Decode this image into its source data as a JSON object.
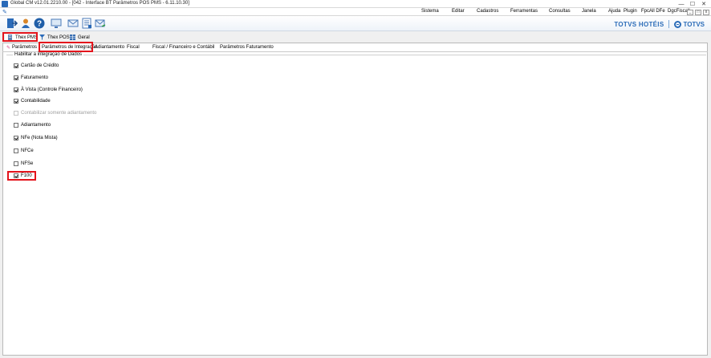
{
  "window": {
    "title": "Global CM v12.01.2210.00 - [042 - Interface BT Parâmetros POS PMS - 6.11.10.30]",
    "controls": [
      "—",
      "☐",
      "✕"
    ]
  },
  "menu": {
    "items": [
      "Sistema",
      "Editar",
      "Cadastros",
      "Ferramentas",
      "Consultas",
      "Janela",
      "Ajuda",
      "Plugin",
      "FpcAll DFe",
      "DgcFiscall"
    ],
    "mini_controls": [
      "_",
      "□",
      "x"
    ]
  },
  "toolbar": {
    "buttons": [
      "exit-icon",
      "user-icon",
      "help-icon",
      "monitor-icon",
      "mail-icon",
      "report-icon",
      "send-mail-icon"
    ],
    "brand_hoteis": "TOTVS HOTÉIS",
    "brand_totvs": "TOTVS"
  },
  "tabs_level1": [
    {
      "label": "Thex PMS",
      "icon": "building-icon",
      "active": true
    },
    {
      "label": "Thex POS",
      "icon": "filter-icon",
      "active": false
    },
    {
      "label": "Geral",
      "icon": "grid-icon",
      "active": false
    }
  ],
  "tabs_level2": [
    {
      "label": "Parâmetros",
      "active": false
    },
    {
      "label": "Parâmetros de Integração",
      "active": true
    },
    {
      "label": "Adiantamento",
      "active": false
    },
    {
      "label": "Fiscal",
      "active": false
    },
    {
      "label": "Fiscal / Financeiro e Contábil",
      "active": false
    },
    {
      "label": "Parâmetros Faturamento",
      "active": false
    }
  ],
  "group": {
    "title": "Habilitar a integração de Dados",
    "checkboxes": [
      {
        "label": "Cartão de Crédito",
        "checked": true,
        "enabled": true
      },
      {
        "label": "Faturamento",
        "checked": true,
        "enabled": true
      },
      {
        "label": "À Vista (Controle Financeiro)",
        "checked": true,
        "enabled": true
      },
      {
        "label": "Contabilidade",
        "checked": true,
        "enabled": true
      },
      {
        "label": "Contabilizar somente adiantamento",
        "checked": false,
        "enabled": false
      },
      {
        "label": "Adiantamento",
        "checked": false,
        "enabled": true
      },
      {
        "label": "NFe (Nota Mista)",
        "checked": true,
        "enabled": true
      },
      {
        "label": "NFCe",
        "checked": false,
        "enabled": true
      },
      {
        "label": "NFSe",
        "checked": false,
        "enabled": true
      },
      {
        "label": "F100",
        "checked": true,
        "enabled": true
      }
    ]
  },
  "colors": {
    "highlight": "#e3141c",
    "brand": "#2b6cb8"
  }
}
